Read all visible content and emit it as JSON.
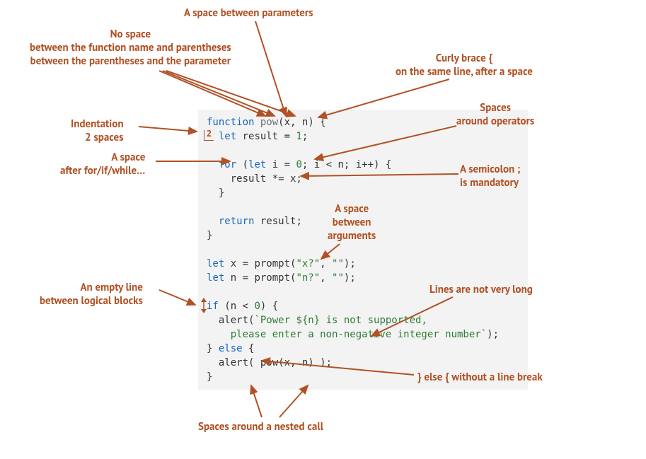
{
  "labels": {
    "space_between_params": "A space between parameters",
    "no_space_func": "No space\nbetween the function name and parentheses\nbetween the parentheses and the parameter",
    "curly_same_line": "Curly brace {\non the same line, after a space",
    "indentation": "Indentation\n2 spaces",
    "space_after_for": "A space\nafter for/if/while…",
    "spaces_operators": "Spaces\naround operators",
    "semicolon": "A semicolon ;\nis mandatory",
    "space_between_args": "A space\nbetween\narguments",
    "empty_line": "An empty line\nbetween logical blocks",
    "lines_not_long": "Lines are not very long",
    "else_no_break": "} else { without a line break",
    "spaces_nested_call": "Spaces around a nested call"
  },
  "code": {
    "l1": {
      "kw": "function",
      "name": "pow",
      "rest": "(x, n) {"
    },
    "l2": {
      "kw": "let",
      "rest": " result = ",
      "num": "1",
      "end": ";"
    },
    "l3": {
      "kw1": "for",
      "par_open": " (",
      "kw2": "let",
      "rest": " i = ",
      "num": "0",
      "mid": "; i < n; i++) {"
    },
    "l4": "    result *= x;",
    "l5": "  }",
    "l6": {
      "kw": "return",
      "rest": " result;"
    },
    "l7": "}",
    "l8": {
      "kw": "let",
      "rest1": " x = prompt(",
      "s1": "\"x?\"",
      "c": ", ",
      "s2": "\"\"",
      "rest2": ");"
    },
    "l9": {
      "kw": "let",
      "rest1": " n = prompt(",
      "s1": "\"n?\"",
      "c": ", ",
      "s2": "\"\"",
      "rest2": ");"
    },
    "l10": {
      "kw": "if",
      "rest": " (n < ",
      "num": "0",
      "end": ") {"
    },
    "l11": {
      "pre": "  alert(",
      "str": "`Power ${n} is not supported,"
    },
    "l12": {
      "str": "    please enter a non-negative integer number`",
      "end": ");"
    },
    "l13": {
      "pre": "} ",
      "kw": "else",
      "end": " {"
    },
    "l14": "  alert( pow(x, n) );",
    "l15": "}"
  },
  "indent_badge": "2"
}
